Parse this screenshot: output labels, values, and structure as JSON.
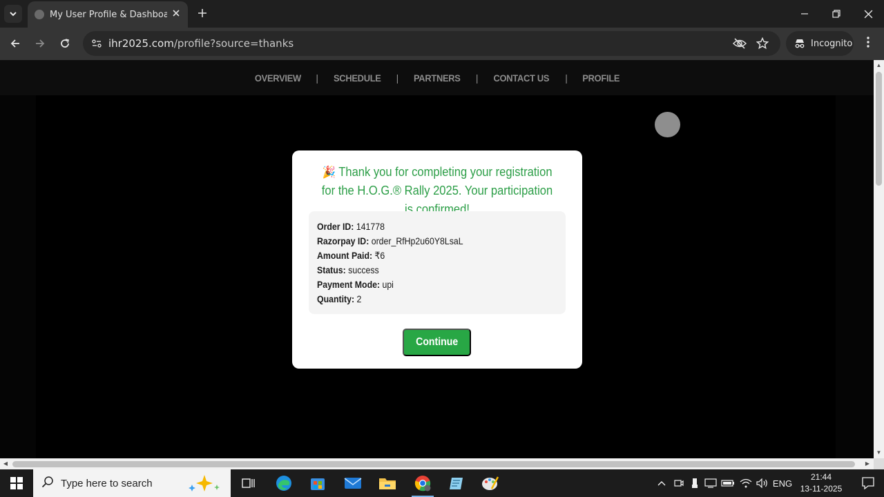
{
  "browser": {
    "tab_title": "My User Profile & Dashboard | I",
    "url_domain": "ihr2025.com",
    "url_path": "/profile?source=thanks",
    "incognito_label": "Incognito"
  },
  "site_nav": {
    "items": [
      "OVERVIEW",
      "SCHEDULE",
      "PARTNERS",
      "CONTACT US",
      "PROFILE"
    ],
    "separator": "|"
  },
  "modal": {
    "heading": "Thank you for completing your registration for the H.O.G.® Rally 2025. Your participation is confirmed!",
    "details": [
      {
        "label": "Order ID:",
        "value": "141778"
      },
      {
        "label": "Razorpay ID:",
        "value": "order_RfHp2u60Y8LsaL"
      },
      {
        "label": "Amount Paid:",
        "value": "₹6"
      },
      {
        "label": "Status:",
        "value": "success"
      },
      {
        "label": "Payment Mode:",
        "value": "upi"
      },
      {
        "label": "Quantity:",
        "value": "2"
      }
    ],
    "continue_label": "Continue"
  },
  "taskbar": {
    "search_placeholder": "Type here to search",
    "language": "ENG",
    "time": "21:44",
    "date": "13-11-2025"
  },
  "colors": {
    "heading_green": "#2c9e47",
    "button_green": "#28a745",
    "page_background": "#000000"
  }
}
